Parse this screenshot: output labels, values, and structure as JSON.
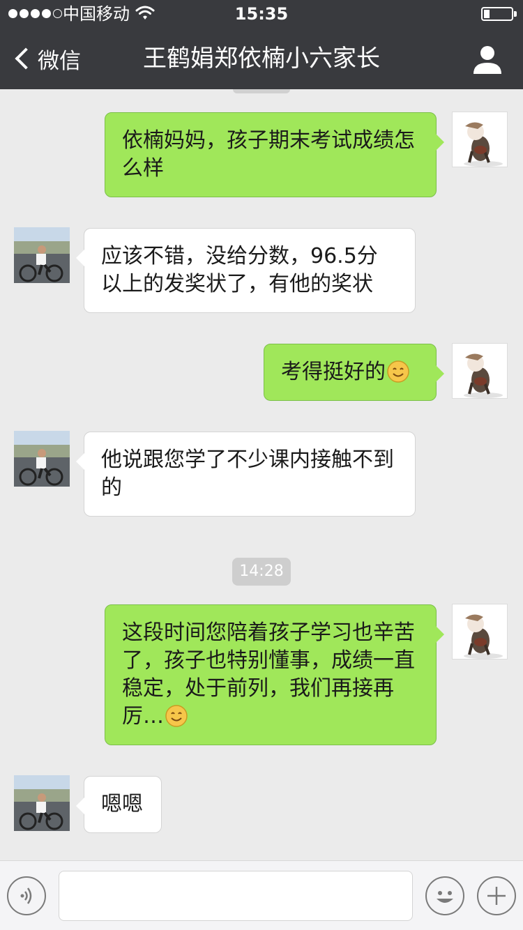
{
  "status_bar": {
    "carrier": "中国移动",
    "time": "15:35"
  },
  "nav": {
    "back_label": "微信",
    "title": "王鹤娟郑依楠小六家长"
  },
  "messages": [
    {
      "from": "me",
      "text": "依楠妈妈，孩子期末考试成绩怎么样"
    },
    {
      "from": "other",
      "text": "应该不错，没给分数，96.5分以上的发奖状了，有他的奖状"
    },
    {
      "from": "me",
      "text": "考得挺好的",
      "emoji": "smile-emoji"
    },
    {
      "from": "other",
      "text": "他说跟您学了不少课内接触不到的"
    },
    {
      "from": "me",
      "text": "这段时间您陪着孩子学习也辛苦了，孩子也特别懂事，成绩一直稳定，处于前列，我们再接再厉…",
      "emoji": "smile-emoji"
    },
    {
      "from": "other",
      "text": "嗯嗯"
    }
  ],
  "timestamp": "14:28",
  "icons": {
    "back": "chevron-left-icon",
    "profile": "person-icon",
    "voice": "voice-icon",
    "emoji": "smiley-icon",
    "more": "plus-icon"
  },
  "colors": {
    "nav_bg": "#393a3e",
    "chat_bg": "#ebebeb",
    "my_bubble": "#a0e75a",
    "their_bubble": "#ffffff"
  }
}
